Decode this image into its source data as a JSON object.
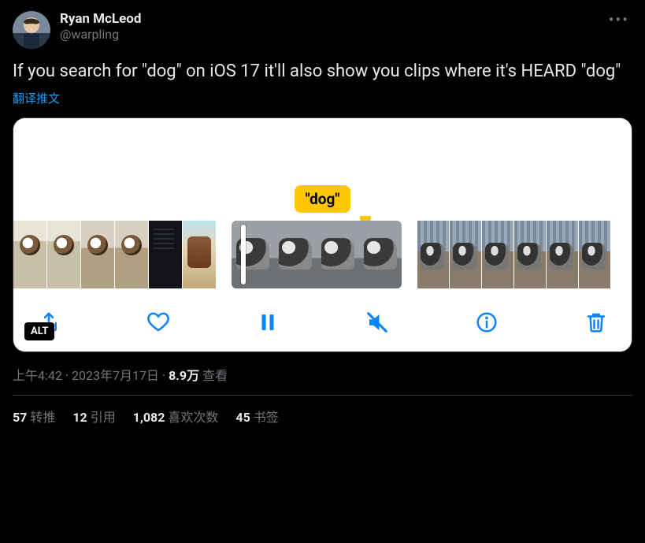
{
  "author": {
    "display_name": "Ryan McLeod",
    "handle": "@warpling"
  },
  "tweet_text": "If you search for \"dog\" on iOS 17 it'll also show you clips where it's HEARD \"dog\"",
  "translate_label": "翻译推文",
  "media": {
    "search_badge": "\"dog\"",
    "alt_badge": "ALT"
  },
  "meta": {
    "time": "上午4:42",
    "sep": " · ",
    "date": "2023年7月17日",
    "views_number": "8.9万",
    "views_label": " 查看"
  },
  "stats": {
    "retweets_n": "57",
    "retweets_l": "转推",
    "quotes_n": "12",
    "quotes_l": "引用",
    "likes_n": "1,082",
    "likes_l": "喜欢次数",
    "bookmarks_n": "45",
    "bookmarks_l": "书签"
  }
}
